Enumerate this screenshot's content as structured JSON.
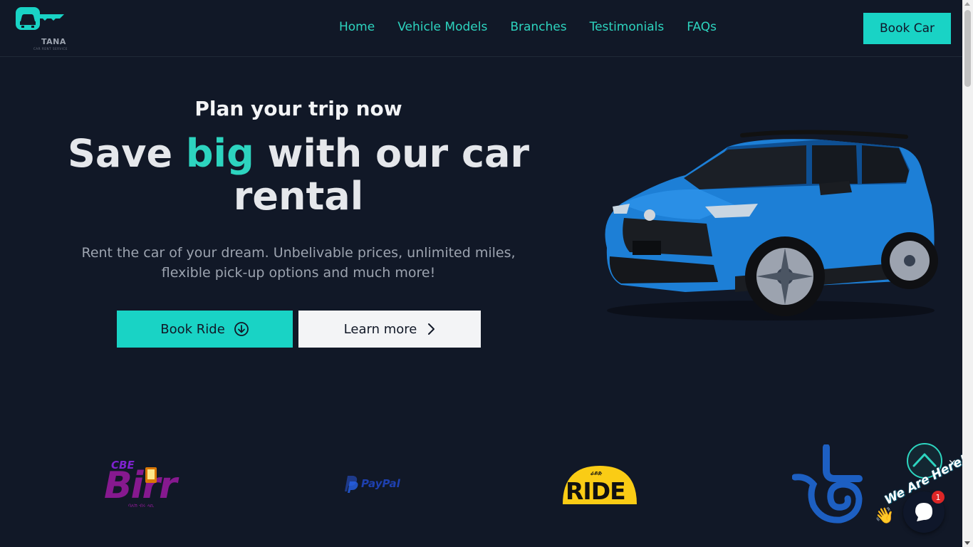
{
  "brand": {
    "name": "TANA",
    "tagline": "CAR RENT SERVICE",
    "accent": "#19d3c5",
    "background": "#111827"
  },
  "nav": {
    "items": [
      {
        "label": "Home"
      },
      {
        "label": "Vehicle Models"
      },
      {
        "label": "Branches"
      },
      {
        "label": "Testimonials"
      },
      {
        "label": "FAQs"
      }
    ],
    "cta_label": "Book Car"
  },
  "hero": {
    "kicker": "Plan your trip now",
    "title_before": "Save ",
    "title_accent": "big",
    "title_after": " with our car rental",
    "description": "Rent the car of your dream. Unbelivable prices, unlimited miles, flexible pick-up options and much more!",
    "primary_button": "Book Ride",
    "secondary_button": "Learn more",
    "image_alt": "blue SUV"
  },
  "partners": {
    "cbe": {
      "top": "CBE",
      "main": "Birr",
      "sub": "ባለሽ ብሩ ላኪ"
    },
    "paypal": {
      "label": "PayPal"
    },
    "ride": {
      "label": "RIDE",
      "amharic": "ራይድ"
    },
    "telebirr": {
      "icon": "telebirr-logo"
    }
  },
  "chat_widget": {
    "greeting": "We Are Here!",
    "badge_count": "1",
    "close": "✕",
    "wave": "👋"
  }
}
